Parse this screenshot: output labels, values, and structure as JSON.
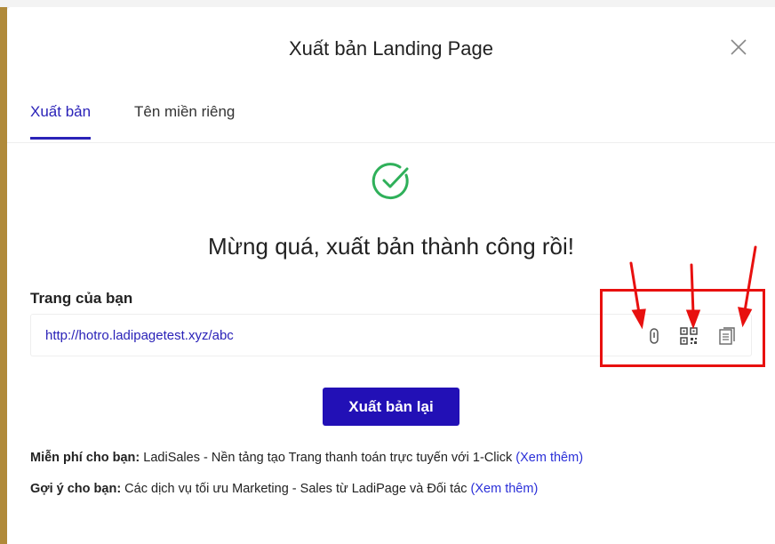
{
  "modal": {
    "title": "Xuất bản Landing Page",
    "close_icon": "close-icon"
  },
  "tabs": [
    {
      "label": "Xuất bản",
      "active": true
    },
    {
      "label": "Tên miền riêng",
      "active": false
    }
  ],
  "success": {
    "icon": "check-circle-icon",
    "message": "Mừng quá, xuất bản thành công rồi!"
  },
  "page": {
    "label": "Trang của bạn",
    "url": "http://hotro.ladipagetest.xyz/abc",
    "actions": [
      "link-icon",
      "qr-code-icon",
      "copy-icon"
    ]
  },
  "republish_button": "Xuất bản lại",
  "notes": [
    {
      "prefix": "Miễn phí cho bạn:",
      "text": " LadiSales - Nền tảng tạo Trang thanh toán trực tuyến với 1-Click ",
      "link": "(Xem thêm)"
    },
    {
      "prefix": "Gợi ý cho bạn:",
      "text": " Các dịch vụ tối ưu Marketing - Sales từ LadiPage và Đối tác ",
      "link": "(Xem thêm)"
    }
  ],
  "colors": {
    "accent": "#2a22b8",
    "button": "#2210b6",
    "success": "#2fb05a",
    "annotation": "#e8100f"
  }
}
